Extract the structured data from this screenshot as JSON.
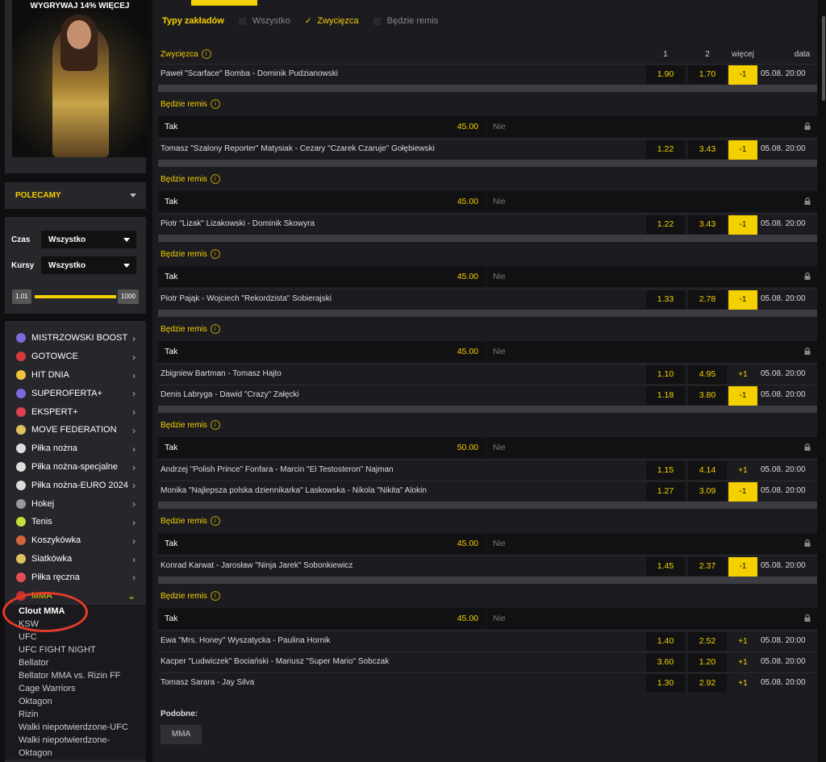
{
  "banner": {
    "promo": "WYGRYWAJ 14% WIĘCEJ"
  },
  "polecamy": {
    "label": "POLECAMY"
  },
  "filters": {
    "czas_label": "Czas",
    "czas_value": "Wszystko",
    "kursy_label": "Kursy",
    "kursy_value": "Wszystko",
    "slider_min": "1.01",
    "slider_max": "1000"
  },
  "sports": [
    {
      "label": "MISTRZOWSKI BOOST",
      "icon": "boost-icon",
      "color": "#7a6adc"
    },
    {
      "label": "GOTOWCE",
      "icon": "gotowce-icon",
      "color": "#d2393b"
    },
    {
      "label": "HIT DNIA",
      "icon": "hit-icon",
      "color": "#f0c040"
    },
    {
      "label": "SUPEROFERTA+",
      "icon": "superoferta-icon",
      "color": "#7a6adc"
    },
    {
      "label": "EKSPERT+",
      "icon": "ekspert-icon",
      "color": "#e04050"
    },
    {
      "label": "MOVE FEDERATION",
      "icon": "move-icon",
      "color": "#e0c060"
    },
    {
      "label": "Piłka nożna",
      "icon": "football-icon",
      "color": "#dddddd"
    },
    {
      "label": "Piłka nożna-specjalne",
      "icon": "football-icon",
      "color": "#dddddd"
    },
    {
      "label": "Piłka nożna-EURO 2024",
      "icon": "football-icon",
      "color": "#dddddd"
    },
    {
      "label": "Hokej",
      "icon": "hockey-icon",
      "color": "#999999"
    },
    {
      "label": "Tenis",
      "icon": "tennis-icon",
      "color": "#c8dc3c"
    },
    {
      "label": "Koszykówka",
      "icon": "basketball-icon",
      "color": "#d2643c"
    },
    {
      "label": "Siatkówka",
      "icon": "volleyball-icon",
      "color": "#e0c060"
    },
    {
      "label": "Piłka ręczna",
      "icon": "handball-icon",
      "color": "#e05050"
    }
  ],
  "mma": {
    "label": "MMA",
    "subitems": [
      "Clout MMA",
      "KSW",
      "UFC",
      "UFC FIGHT NIGHT",
      "Bellator",
      "Bellator MMA vs. Rizin FF",
      "Cage Warriors",
      "Oktagon",
      "Rizin",
      "Walki niepotwierdzone-UFC",
      "Walki niepotwierdzone-",
      "Oktagon"
    ]
  },
  "bet_types": {
    "title": "Typy zakładów",
    "options": [
      {
        "label": "Wszystko",
        "checked": false
      },
      {
        "label": "Zwycięzca",
        "checked": true
      },
      {
        "label": "Będzie remis",
        "checked": false
      }
    ]
  },
  "market_header": {
    "title": "Zwycięzca",
    "col1": "1",
    "col2": "2",
    "col_more": "więcej",
    "col_date": "data"
  },
  "draw": {
    "title": "Będzie remis",
    "yes": "Tak",
    "no": "Nie"
  },
  "fights": [
    {
      "name": "Paweł \"Scarface\" Bomba - Dominik Pudzianowski",
      "o1": "1.90",
      "o2": "1.70",
      "more": "-1",
      "date": "05.08. 20:00",
      "draw_odds": "45.00"
    },
    {
      "name": "Tomasz \"Szalony Reporter\" Matysiak - Cezary \"Czarek Czaruje\" Gołębiewski",
      "o1": "1.22",
      "o2": "3.43",
      "more": "-1",
      "date": "05.08. 20:00",
      "draw_odds": "45.00"
    },
    {
      "name": "Piotr \"Lizak\" Lizakowski - Dominik Skowyra",
      "o1": "1.22",
      "o2": "3.43",
      "more": "-1",
      "date": "05.08. 20:00",
      "draw_odds": "45.00"
    },
    {
      "name": "Piotr Pająk - Wojciech \"Rekordzista\" Sobierajski",
      "o1": "1.33",
      "o2": "2.78",
      "more": "-1",
      "date": "05.08. 20:00",
      "draw_odds": "45.00"
    },
    {
      "name": "Zbigniew Bartman - Tomasz Hajto",
      "o1": "1.10",
      "o2": "4.95",
      "more": "+1",
      "date": "05.08. 20:00"
    },
    {
      "name": "Denis Labryga - Dawid \"Crazy\" Załęcki",
      "o1": "1.18",
      "o2": "3.80",
      "more": "-1",
      "date": "05.08. 20:00",
      "draw_odds": "50.00"
    },
    {
      "name": "Andrzej \"Polish Prince\" Fonfara - Marcin \"El Testosteron\" Najman",
      "o1": "1.15",
      "o2": "4.14",
      "more": "+1",
      "date": "05.08. 20:00"
    },
    {
      "name": "Monika \"Najlepsza polska dziennikarka\" Laskowska - Nikola \"Nikita\" Alokin",
      "o1": "1.27",
      "o2": "3.09",
      "more": "-1",
      "date": "05.08. 20:00",
      "draw_odds": "45.00"
    },
    {
      "name": "Konrad Karwat - Jarosław \"Ninja Jarek\" Sobonkiewicz",
      "o1": "1.45",
      "o2": "2.37",
      "more": "-1",
      "date": "05.08. 20:00",
      "draw_odds": "45.00"
    },
    {
      "name": "Ewa \"Mrs. Honey\" Wyszatycka - Paulina Hornik",
      "o1": "1.40",
      "o2": "2.52",
      "more": "+1",
      "date": "05.08. 20:00"
    },
    {
      "name": "Kacper \"Ludwiczek\" Bociański - Mariusz \"Super Mario\" Sobczak",
      "o1": "3.60",
      "o2": "1.20",
      "more": "+1",
      "date": "05.08. 20:00"
    },
    {
      "name": "Tomasz Sarara - Jay Silva",
      "o1": "1.30",
      "o2": "2.92",
      "more": "+1",
      "date": "05.08. 20:00"
    }
  ],
  "similar": {
    "title": "Podobne:",
    "tag": "MMA"
  },
  "colors": {
    "accent": "#f5d000",
    "annotation": "#e53b2b"
  }
}
